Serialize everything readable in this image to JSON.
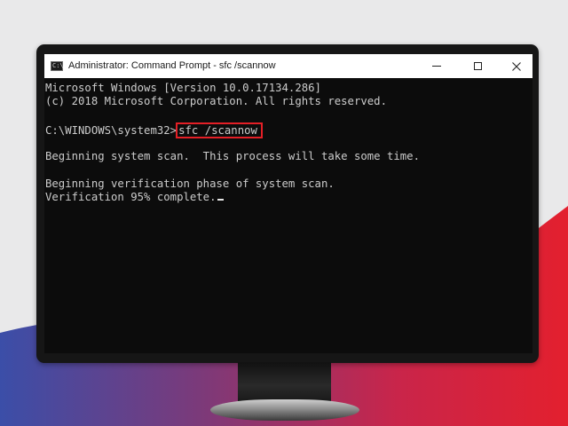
{
  "window": {
    "title": "Administrator: Command Prompt - sfc  /scannow",
    "icon": "command-prompt-icon",
    "buttons": {
      "minimize": "minimize-icon",
      "maximize": "maximize-icon",
      "close": "close-icon"
    }
  },
  "console": {
    "version_line": "Microsoft Windows [Version 10.0.17134.286]",
    "copyright_line": "(c) 2018 Microsoft Corporation. All rights reserved.",
    "prompt": "C:\\WINDOWS\\system32>",
    "command": "sfc /scannow",
    "scan_line": "Beginning system scan.  This process will take some time.",
    "verify_line": "Beginning verification phase of system scan.",
    "progress_line": "Verification 95% complete."
  },
  "colors": {
    "console_bg": "#0c0c0c",
    "console_text": "#cccccc",
    "highlight_box": "#e41f26",
    "bg_blue": "#3b4ea8",
    "bg_red": "#e0202f"
  }
}
